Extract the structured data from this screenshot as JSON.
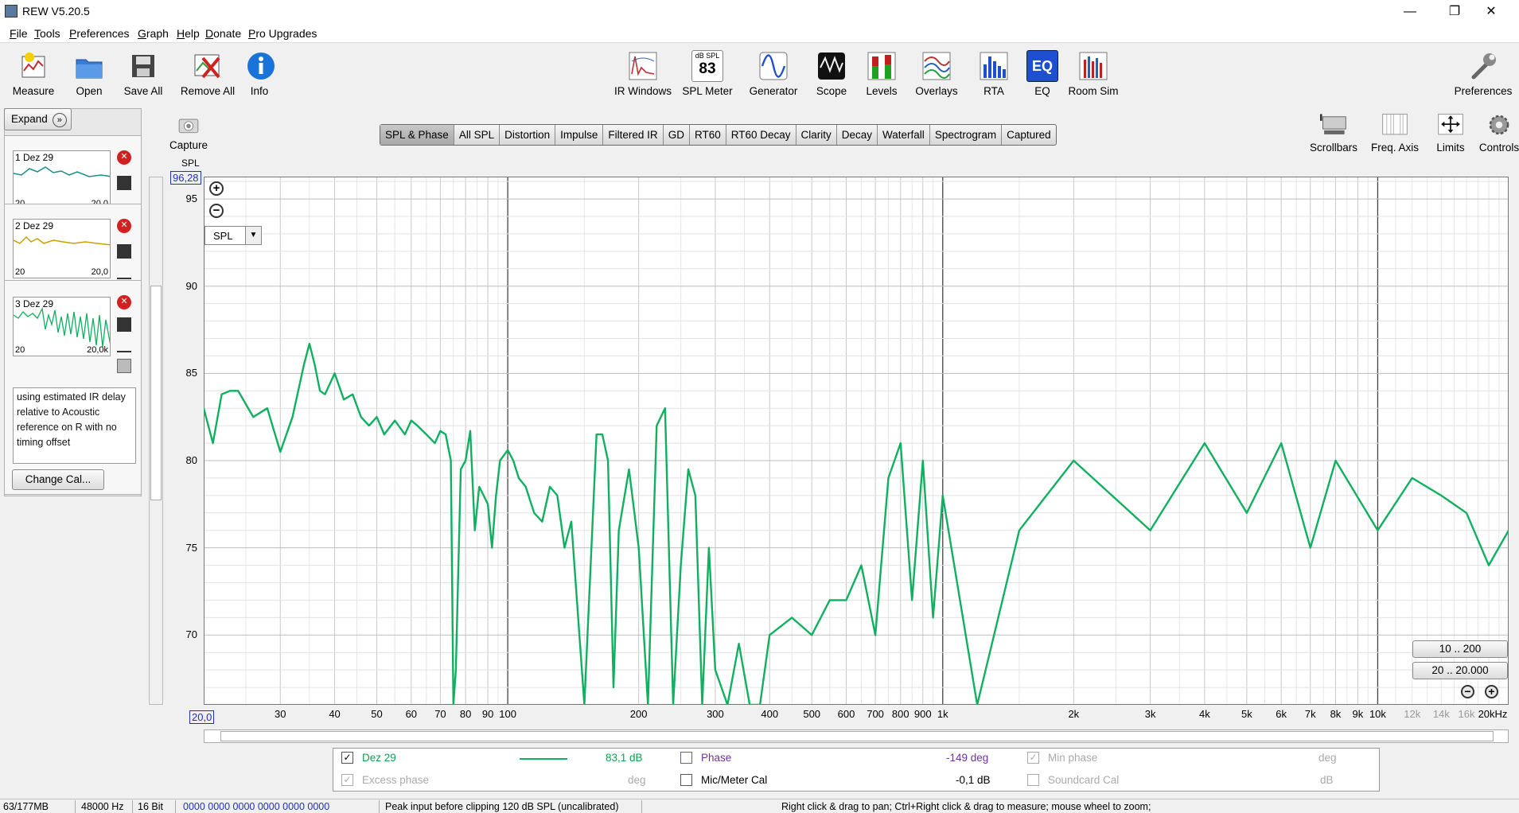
{
  "window": {
    "title": "REW V5.20.5",
    "minimize": "—",
    "maximize": "❐",
    "close": "✕"
  },
  "menu": [
    "File",
    "Tools",
    "Preferences",
    "Graph",
    "Help",
    "Donate",
    "Pro Upgrades"
  ],
  "toolbar": {
    "left": [
      "Measure",
      "Open",
      "Save All",
      "Remove All",
      "Info"
    ],
    "center": [
      "IR Windows",
      "SPL Meter",
      "Generator",
      "Scope",
      "Levels",
      "Overlays",
      "RTA",
      "EQ",
      "Room Sim"
    ],
    "spl_meter_unit": "dB SPL",
    "spl_meter_value": "83",
    "eq_icon_text": "EQ",
    "right": "Preferences",
    "capture": "Capture"
  },
  "tabs": [
    "SPL & Phase",
    "All SPL",
    "Distortion",
    "Impulse",
    "Filtered IR",
    "GD",
    "RT60",
    "RT60 Decay",
    "Clarity",
    "Decay",
    "Waterfall",
    "Spectrogram",
    "Captured"
  ],
  "active_tab": "SPL & Phase",
  "right_tools": [
    "Scrollbars",
    "Freq. Axis",
    "Limits",
    "Controls"
  ],
  "left_panel": {
    "expand": "Expand",
    "measurements": [
      {
        "num": "1",
        "name": "Dez 29",
        "lo": "20",
        "hi": "20,0",
        "color": "#1c8c8c"
      },
      {
        "num": "2",
        "name": "Dez 29",
        "lo": "20",
        "hi": "20,0",
        "color": "#c8a000"
      },
      {
        "num": "3",
        "name": "Dez 29",
        "lo": "20",
        "hi": "20,0k",
        "color": "#10b060"
      }
    ],
    "notes": "using estimated IR delay relative to Acoustic reference on  R with no timing offset",
    "change_cal": "Change Cal..."
  },
  "graph": {
    "y_title": "SPL",
    "y_top_value": "96,28",
    "x_left_value": "20,0",
    "y_ticks": [
      "95",
      "90",
      "85",
      "80",
      "75",
      "70"
    ],
    "x_ticks": [
      "30",
      "40",
      "50",
      "60",
      "70",
      "80",
      "90",
      "100",
      "200",
      "300",
      "400",
      "500",
      "600",
      "700",
      "800",
      "900",
      "1k",
      "2k",
      "3k",
      "4k",
      "5k",
      "6k",
      "7k",
      "8k",
      "9k",
      "10k",
      "12k",
      "14k",
      "16k",
      "20kHz"
    ],
    "dropdown": "SPL",
    "zoom_btns": [
      "10 .. 200",
      "20 .. 20.000"
    ]
  },
  "chart_data": {
    "type": "line",
    "title": "",
    "xlabel": "",
    "ylabel": "SPL",
    "x_scale": "log",
    "xlim": [
      20,
      20000
    ],
    "ylim": [
      66,
      96.28
    ],
    "series": [
      {
        "name": "Dez 29",
        "color": "#10b060",
        "x": [
          20,
          21,
          22,
          23,
          24,
          26,
          28,
          30,
          32,
          34,
          35,
          36,
          37,
          38,
          40,
          42,
          44,
          46,
          48,
          50,
          52,
          55,
          58,
          60,
          62,
          65,
          68,
          70,
          72,
          74,
          75,
          76,
          77,
          78,
          80,
          82,
          84,
          86,
          88,
          90,
          92,
          94,
          96,
          100,
          103,
          106,
          110,
          115,
          120,
          125,
          130,
          135,
          140,
          150,
          160,
          165,
          170,
          175,
          180,
          190,
          200,
          210,
          220,
          230,
          240,
          250,
          260,
          270,
          280,
          290,
          300,
          320,
          340,
          360,
          380,
          400,
          450,
          500,
          550,
          600,
          650,
          700,
          750,
          800,
          850,
          900,
          950,
          1000,
          1200,
          1500,
          2000,
          3000,
          4000,
          5000,
          6000,
          7000,
          8000,
          10000,
          12000,
          14000,
          16000,
          18000,
          20000
        ],
        "y": [
          83,
          81,
          83.8,
          84,
          84,
          82.5,
          83,
          80.5,
          82.5,
          85.5,
          86.7,
          85.5,
          84,
          83.8,
          85,
          83.5,
          83.8,
          82.5,
          82,
          82.5,
          81.5,
          82.3,
          81.5,
          82.3,
          82,
          81.5,
          81,
          81.7,
          81.5,
          80,
          66,
          68,
          74,
          79.5,
          80,
          81.7,
          76,
          78.5,
          78,
          77.5,
          75,
          78,
          80,
          80.6,
          80,
          79,
          78.5,
          77,
          76.5,
          78.5,
          78,
          75,
          76.5,
          66,
          81.5,
          81.5,
          80,
          67,
          76,
          79.5,
          75,
          66,
          82,
          83,
          66,
          74,
          79.5,
          78,
          66,
          75,
          68,
          66,
          69.5,
          66,
          66,
          70,
          71,
          70,
          72,
          72,
          74,
          70,
          79,
          81,
          72,
          80,
          71,
          78,
          66,
          76,
          80,
          76,
          81,
          77,
          81,
          75,
          80,
          76,
          79,
          78,
          77,
          74,
          76
        ]
      }
    ]
  },
  "legend": {
    "row1": {
      "name": "Dez 29",
      "value": "83,1 dB",
      "phase_label": "Phase",
      "phase_value": "-149 deg",
      "min_phase": "Min phase",
      "min_phase_unit": "deg"
    },
    "row2": {
      "excess": "Excess phase",
      "excess_unit": "deg",
      "mic": "Mic/Meter Cal",
      "mic_value": "-0,1 dB",
      "soundcard": "Soundcard Cal",
      "soundcard_unit": "dB"
    }
  },
  "status": {
    "mem": "63/177MB",
    "rate": "48000 Hz",
    "bits": "16 Bit",
    "bits_display": "0000 0000  0000 0000  0000 0000",
    "peak": "Peak input before clipping 120 dB SPL (uncalibrated)",
    "hint": "Right click & drag to pan; Ctrl+Right click & drag to measure; mouse wheel to zoom;"
  }
}
